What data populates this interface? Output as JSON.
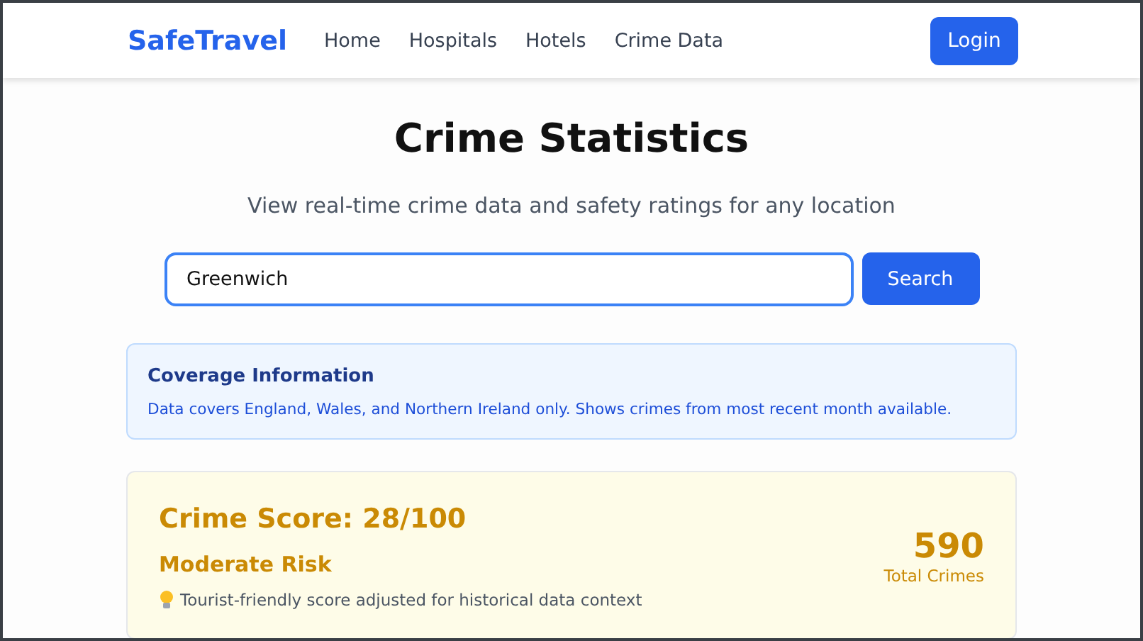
{
  "header": {
    "logo": "SafeTravel",
    "nav": [
      {
        "label": "Home"
      },
      {
        "label": "Hospitals"
      },
      {
        "label": "Hotels"
      },
      {
        "label": "Crime Data"
      }
    ],
    "login": "Login"
  },
  "title": "Crime Statistics",
  "subtitle": "View real-time crime data and safety ratings for any location",
  "search": {
    "value": "Greenwich",
    "button": "Search"
  },
  "coverage": {
    "title": "Coverage Information",
    "text": "Data covers England, Wales, and Northern Ireland only. Shows crimes from most recent month available."
  },
  "score_card": {
    "score": "Crime Score: 28/100",
    "risk": "Moderate Risk",
    "note": "Tourist-friendly score adjusted for historical data context",
    "total": "590",
    "total_label": "Total Crimes"
  }
}
